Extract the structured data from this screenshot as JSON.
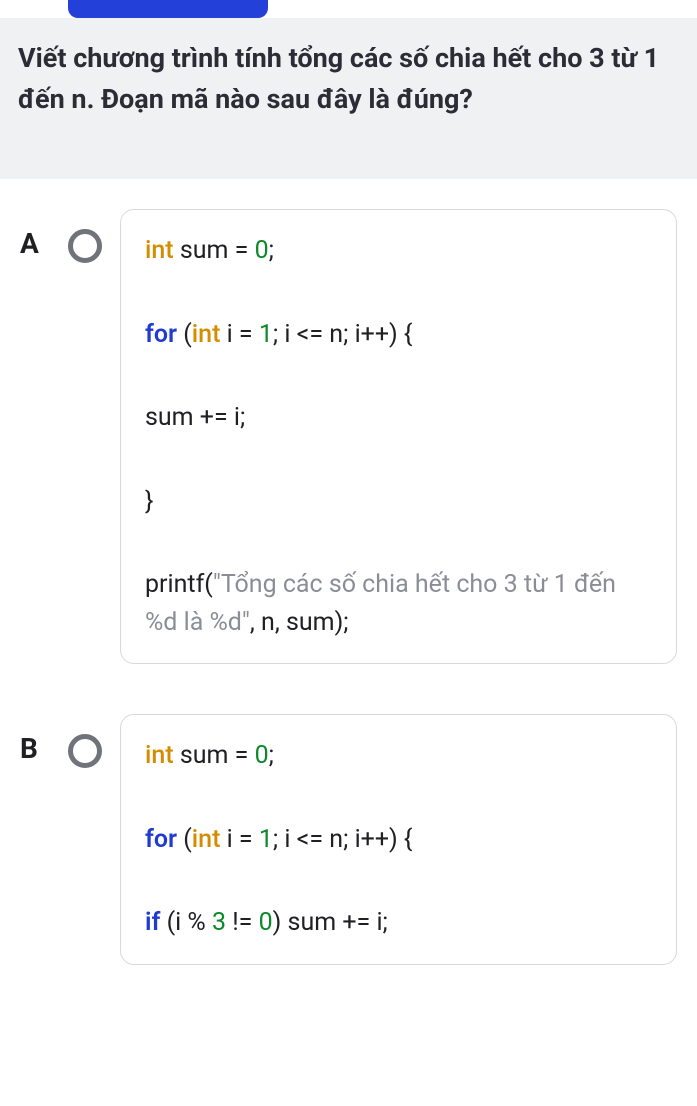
{
  "question": "Viết chương trình tính tổng các số chia hết cho 3 từ 1 đến n. Đoạn mã nào sau đây là đúng?",
  "answers": [
    {
      "letter": "A",
      "code_tokens": [
        [
          {
            "t": "int",
            "c": "type"
          },
          {
            "t": " sum = "
          },
          {
            "t": "0",
            "c": "num"
          },
          {
            "t": ";"
          }
        ],
        [
          {
            "t": "for",
            "c": "kw"
          },
          {
            "t": " ("
          },
          {
            "t": "int",
            "c": "type"
          },
          {
            "t": " i = "
          },
          {
            "t": "1",
            "c": "num"
          },
          {
            "t": "; i <= n; i++) {"
          }
        ],
        [
          {
            "t": "    sum += i;"
          }
        ],
        [
          {
            "t": "}"
          }
        ],
        [
          {
            "t": "printf("
          },
          {
            "t": "\"Tổng các số chia hết cho 3 từ 1 đến %d là %d\"",
            "c": "str"
          },
          {
            "t": ", n, sum);"
          }
        ]
      ]
    },
    {
      "letter": "B",
      "code_tokens": [
        [
          {
            "t": "int",
            "c": "type"
          },
          {
            "t": " sum = "
          },
          {
            "t": "0",
            "c": "num"
          },
          {
            "t": ";"
          }
        ],
        [
          {
            "t": "for",
            "c": "kw"
          },
          {
            "t": " ("
          },
          {
            "t": "int",
            "c": "type"
          },
          {
            "t": " i = "
          },
          {
            "t": "1",
            "c": "num"
          },
          {
            "t": "; i <= n; i++) {"
          }
        ],
        [
          {
            "t": "    "
          },
          {
            "t": "if",
            "c": "kw"
          },
          {
            "t": " (i % "
          },
          {
            "t": "3",
            "c": "num"
          },
          {
            "t": " != "
          },
          {
            "t": "0",
            "c": "num"
          },
          {
            "t": ") sum += i;"
          }
        ]
      ]
    }
  ]
}
